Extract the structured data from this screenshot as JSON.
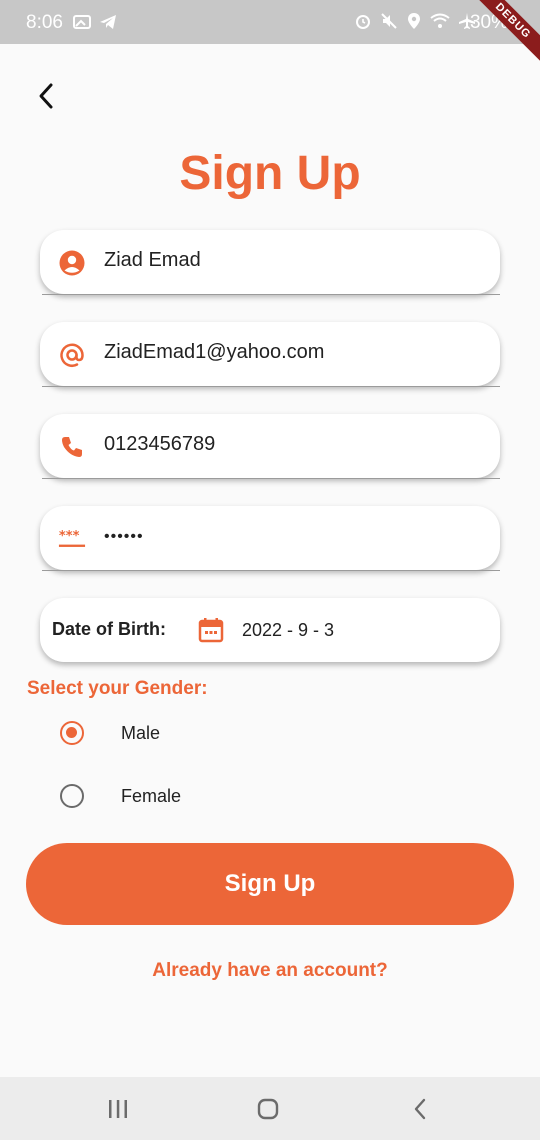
{
  "status_bar": {
    "time": "8:06",
    "battery": "30%",
    "debug_banner": "DEBUG"
  },
  "page": {
    "title": "Sign Up"
  },
  "form": {
    "name": {
      "value": "Ziad Emad",
      "icon": "person-icon"
    },
    "email": {
      "value": "ZiadEmad1@yahoo.com",
      "icon": "at-icon"
    },
    "phone": {
      "value": "0123456789",
      "icon": "phone-icon"
    },
    "password": {
      "value": "••••••",
      "icon": "password-icon"
    },
    "dob": {
      "label": "Date of Birth:",
      "value": "2022 - 9 - 3",
      "icon": "calendar-icon"
    }
  },
  "gender": {
    "label": "Select your Gender:",
    "options": [
      {
        "label": "Male",
        "selected": true
      },
      {
        "label": "Female",
        "selected": false
      }
    ]
  },
  "actions": {
    "signup_label": "Sign Up",
    "login_link": "Already have an account?"
  },
  "colors": {
    "accent": "#ec6638",
    "status_bar_bg": "#c7c7c7",
    "background": "#fafafa"
  }
}
